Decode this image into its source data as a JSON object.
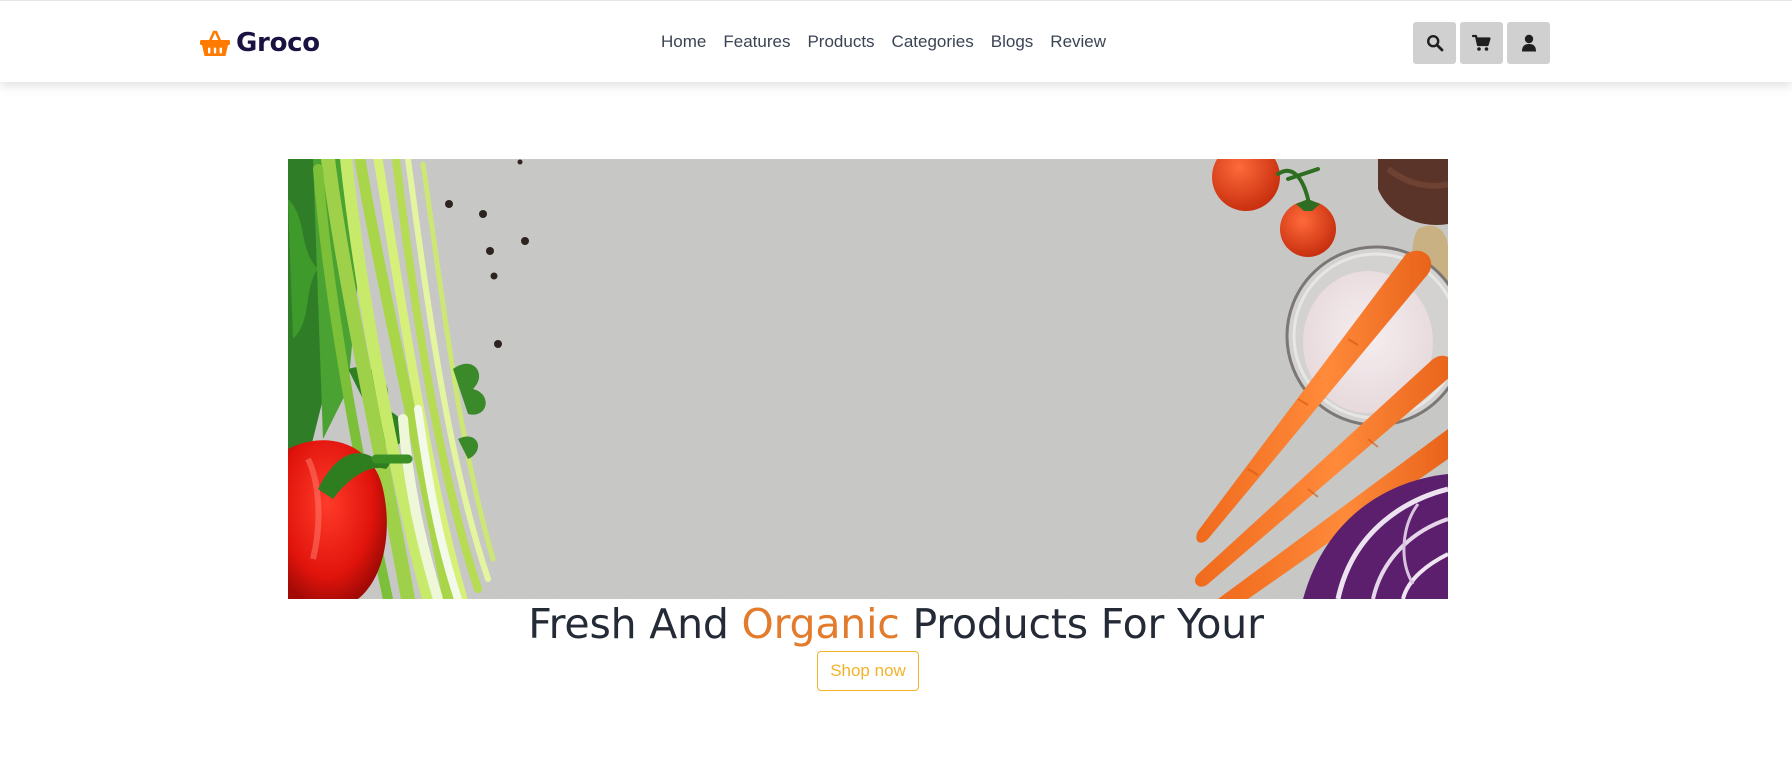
{
  "brand": {
    "name": "Groco",
    "icon": "shopping-basket-icon",
    "icon_color": "#ff7a00",
    "text_color": "#1a1240"
  },
  "nav": {
    "items": [
      {
        "label": "Home"
      },
      {
        "label": "Features"
      },
      {
        "label": "Products"
      },
      {
        "label": "Categories"
      },
      {
        "label": "Blogs"
      },
      {
        "label": "Review"
      }
    ]
  },
  "header_icons": [
    {
      "name": "search-icon"
    },
    {
      "name": "cart-icon"
    },
    {
      "name": "user-icon"
    }
  ],
  "hero": {
    "image": "vegetables-on-grey-stone-background",
    "headline_before": "Fresh And ",
    "headline_accent": "Organic",
    "headline_after": " Products For Your",
    "cta_label": "Shop now"
  },
  "colors": {
    "accent_orange": "#e37b2c",
    "cta_yellow": "#f3b22a",
    "icon_button_bg": "#d0d0d0",
    "headline_text": "#242a36"
  }
}
